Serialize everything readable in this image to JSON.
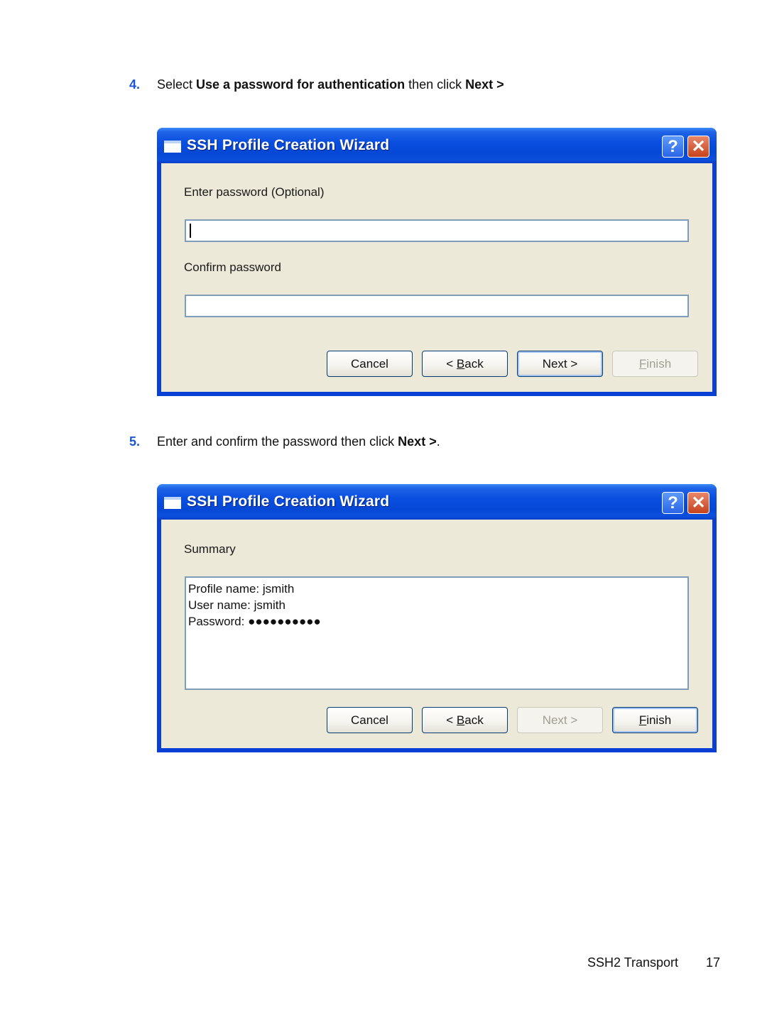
{
  "steps": [
    {
      "number": "4.",
      "text_parts": [
        "Select ",
        "Use a password for authentication",
        " then click ",
        "Next >",
        ""
      ]
    },
    {
      "number": "5.",
      "text_parts": [
        "Enter and confirm the password then click ",
        "Next >",
        "."
      ]
    }
  ],
  "dialogs": [
    {
      "title": "SSH Profile Creation Wizard",
      "help_glyph": "?",
      "close_glyph": "✕",
      "password_label": "Enter password (Optional)",
      "password_value": "",
      "confirm_label": "Confirm password",
      "confirm_value": "",
      "buttons": {
        "cancel": "Cancel",
        "back_prefix": "< ",
        "back_mnemonic": "B",
        "back_rest": "ack",
        "next": "Next >",
        "finish_mnemonic": "F",
        "finish_rest": "inish"
      },
      "button_states": {
        "next": "default",
        "finish": "disabled"
      }
    },
    {
      "title": "SSH Profile Creation Wizard",
      "help_glyph": "?",
      "close_glyph": "✕",
      "summary_label": "Summary",
      "summary_lines": [
        "Profile name: jsmith",
        "User name: jsmith",
        "Password: ●●●●●●●●●●"
      ],
      "buttons": {
        "cancel": "Cancel",
        "back_prefix": "< ",
        "back_mnemonic": "B",
        "back_rest": "ack",
        "next": "Next >",
        "finish_mnemonic": "F",
        "finish_rest": "inish"
      },
      "button_states": {
        "next": "disabled",
        "finish": "default"
      }
    }
  ],
  "footer": {
    "section": "SSH2 Transport",
    "page_number": "17"
  },
  "colors": {
    "step_number": "#1a57d6",
    "titlebar": "#0a4fe0",
    "dialog_bg": "#ece9d8",
    "close_button": "#c6421c"
  }
}
